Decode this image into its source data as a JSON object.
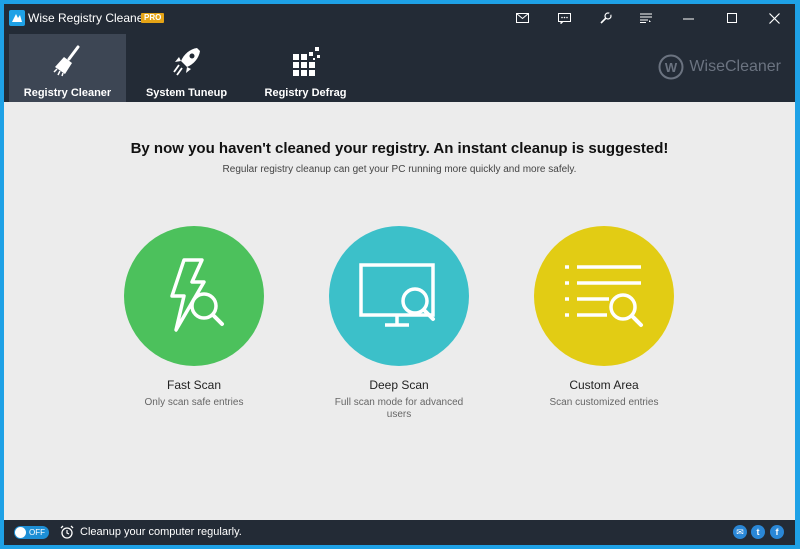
{
  "window": {
    "title": "Wise Registry Cleaner X",
    "badge": "PRO",
    "titlebar_icons": [
      "mail-icon",
      "feedback-icon",
      "settings-icon",
      "menu-icon",
      "minimize-icon",
      "maximize-icon",
      "close-icon"
    ]
  },
  "tabs": [
    {
      "label": "Registry Cleaner",
      "icon": "broom-icon",
      "active": true
    },
    {
      "label": "System Tuneup",
      "icon": "rocket-icon",
      "active": false
    },
    {
      "label": "Registry Defrag",
      "icon": "defrag-icon",
      "active": false
    }
  ],
  "brand": {
    "name": "WiseCleaner",
    "logo_letter": "W"
  },
  "main": {
    "headline": "By now you haven't cleaned your registry. An instant cleanup is suggested!",
    "subline": "Regular registry cleanup can get your PC running more quickly and more safely.",
    "options": [
      {
        "title": "Fast Scan",
        "desc": "Only scan safe entries",
        "color": "#4cc15c",
        "icon": "lightning-search-icon"
      },
      {
        "title": "Deep Scan",
        "desc": "Full scan mode for advanced users",
        "color": "#3cc0c9",
        "icon": "monitor-search-icon"
      },
      {
        "title": "Custom Area",
        "desc": "Scan customized entries",
        "color": "#e2cc14",
        "icon": "list-search-icon"
      }
    ]
  },
  "status": {
    "toggle_label": "OFF",
    "message": "Cleanup your computer regularly.",
    "social_icons": [
      "email-icon",
      "twitter-icon",
      "facebook-icon"
    ],
    "social_glyphs": [
      "✉",
      "t",
      "f"
    ]
  },
  "colors": {
    "border": "#1ea1e6",
    "titlebar": "#232b36",
    "active_tab": "#3d4654",
    "background": "#ececec",
    "pro_badge": "#e5a416"
  }
}
